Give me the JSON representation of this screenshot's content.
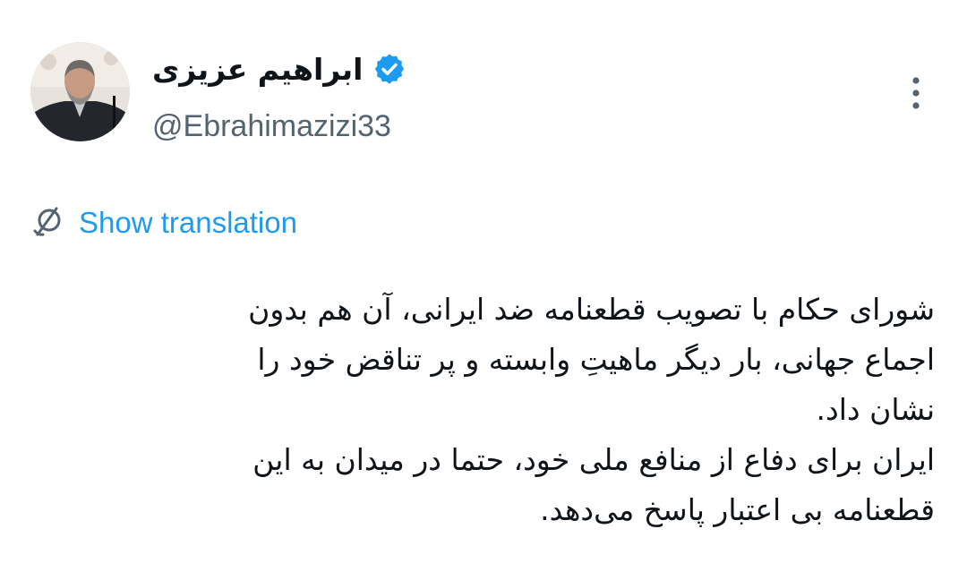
{
  "author": {
    "display_name": "ابراهیم عزیزی",
    "handle": "@Ebrahimazizi33",
    "verified": true
  },
  "icons": {
    "verified": "verified-badge-icon",
    "more": "more-vertical-icon",
    "translate": "globe-translate-icon"
  },
  "colors": {
    "accent": "#1d9bf0",
    "text": "#0f1419",
    "secondary": "#536471"
  },
  "translation": {
    "label": "Show translation"
  },
  "tweet": {
    "lines": [
      "شورای حکام با تصویب قطعنامه ضد ایرانی، آن هم بدون",
      "اجماع جهانی، بار دیگر ماهیتِ وابسته و پر تناقض خود را",
      "نشان داد.",
      "ایران برای دفاع از منافع ملی خود، حتما در میدان به این",
      "قطعنامه بی اعتبار پاسخ می‌دهد."
    ]
  }
}
